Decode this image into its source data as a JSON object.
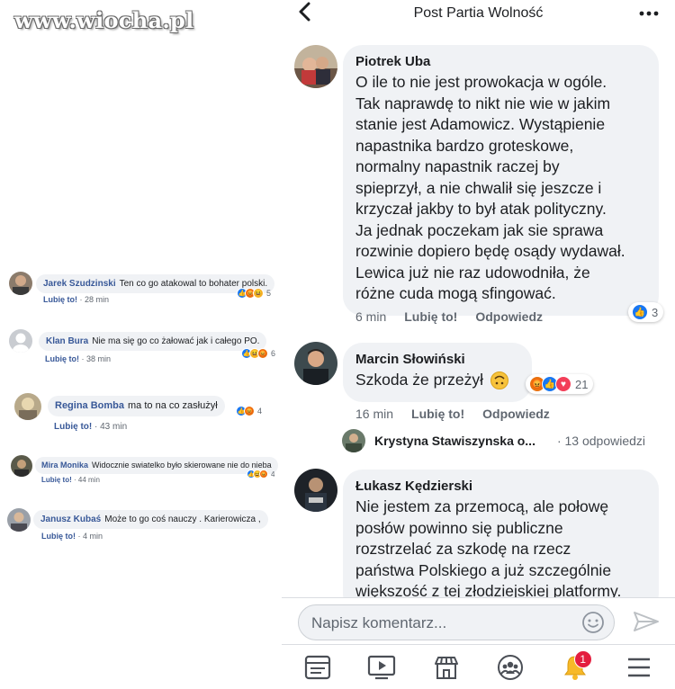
{
  "watermark": "www.wiocha.pl",
  "left_comments": [
    {
      "name": "Jarek Szudzinski",
      "text": "Ten co go atakowal to bohater polski.",
      "like": "Lubię to!",
      "time": "28 min",
      "count": "5"
    },
    {
      "name": "Klan Bura",
      "text": "Nie ma się go co żałować jak i całego PO.",
      "like": "Lubię to!",
      "time": "38 min",
      "count": "6"
    },
    {
      "name": "Regina Bomba",
      "text": "ma to na co zasłużył",
      "like": "Lubię to!",
      "time": "43 min",
      "count": "4"
    },
    {
      "name": "Mira Monika",
      "text": "Widocznie swiatelko było skierowane nie do nieba",
      "like": "Lubię to!",
      "time": "44 min",
      "count": "4"
    },
    {
      "name": "Janusz Kubaś",
      "text": "Może to go coś nauczy . Karierowicza ,",
      "like": "Lubię to!",
      "time": "4 min",
      "count": ""
    }
  ],
  "header": {
    "title": "Post Partia Wolność"
  },
  "comments": [
    {
      "name": "Piotrek Uba",
      "lines": [
        "O ile to nie jest prowokacja w ogóle.",
        "Tak naprawdę to nikt nie wie w jakim",
        "stanie jest Adamowicz. Wystąpienie",
        "napastnika bardzo groteskowe,",
        "normalny napastnik raczej by",
        "spieprzył, a nie chwalił się jeszcze i",
        "krzyczał jakby to był atak polityczny.",
        "Ja jednak poczekam jak sie sprawa",
        "rozwinie dopiero będę osądy wydawał.",
        "Lewica już nie raz udowodniła, że",
        "różne cuda mogą sfingować."
      ],
      "time": "6 min",
      "like": "Lubię to!",
      "reply": "Odpowiedz",
      "reactions": "3"
    },
    {
      "name": "Marcin Słowiński",
      "lines": [
        "Szkoda że przeżył"
      ],
      "time": "16 min",
      "like": "Lubię to!",
      "reply": "Odpowiedz",
      "reactions": "21"
    },
    {
      "name": "Łukasz Kędzierski",
      "lines": [
        "Nie jestem za przemocą, ale połowę",
        "posłów powinno się publiczne",
        "rozstrzelać za szkodę na rzecz",
        "państwa Polskiego a już szczególnie",
        "większość z tej złodziejskiej platformy."
      ]
    }
  ],
  "reply_preview": {
    "name": "Krystyna Stawiszynska o...",
    "count": "· 13 odpowiedzi"
  },
  "composer": {
    "placeholder": "Napisz komentarz..."
  },
  "tabbar": {
    "notification_badge": "1"
  },
  "colors": {
    "link": "#385898",
    "like": "#1877f2",
    "bubble": "#f0f2f5",
    "badge": "#e41e3f"
  }
}
